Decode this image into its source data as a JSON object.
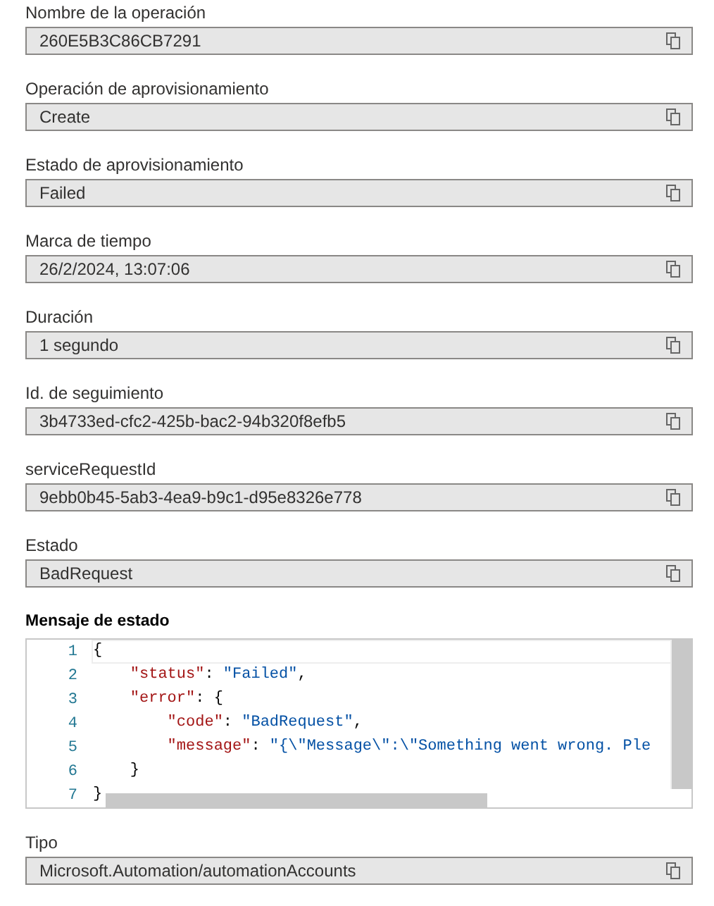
{
  "fields": [
    {
      "kind": "text",
      "label": "Nombre de la operación",
      "value": "260E5B3C86CB7291"
    },
    {
      "kind": "text",
      "label": "Operación de aprovisionamiento",
      "value": "Create"
    },
    {
      "kind": "text",
      "label": "Estado de aprovisionamiento",
      "value": "Failed"
    },
    {
      "kind": "text",
      "label": "Marca de tiempo",
      "value": "26/2/2024, 13:07:06"
    },
    {
      "kind": "text",
      "label": "Duración",
      "value": "1 segundo"
    },
    {
      "kind": "text",
      "label": "Id. de seguimiento",
      "value": "3b4733ed-cfc2-425b-bac2-94b320f8efb5"
    },
    {
      "kind": "text",
      "label": "serviceRequestId",
      "value": "9ebb0b45-5ab3-4ea9-b9c1-d95e8326e778"
    },
    {
      "kind": "text",
      "label": "Estado",
      "value": "BadRequest"
    },
    {
      "kind": "code",
      "label": "Mensaje de estado",
      "lines": [
        {
          "number": "1",
          "selected": true,
          "tokens": [
            {
              "kind": "punct",
              "text": "{"
            }
          ]
        },
        {
          "number": "2",
          "selected": false,
          "tokens": [
            {
              "kind": "key",
              "text": "    \"status\""
            },
            {
              "kind": "punct",
              "text": ": "
            },
            {
              "kind": "string",
              "text": "\"Failed\""
            },
            {
              "kind": "punct",
              "text": ","
            }
          ]
        },
        {
          "number": "3",
          "selected": false,
          "tokens": [
            {
              "kind": "key",
              "text": "    \"error\""
            },
            {
              "kind": "punct",
              "text": ": {"
            }
          ]
        },
        {
          "number": "4",
          "selected": false,
          "tokens": [
            {
              "kind": "key",
              "text": "        \"code\""
            },
            {
              "kind": "punct",
              "text": ": "
            },
            {
              "kind": "string",
              "text": "\"BadRequest\""
            },
            {
              "kind": "punct",
              "text": ","
            }
          ]
        },
        {
          "number": "5",
          "selected": false,
          "tokens": [
            {
              "kind": "key",
              "text": "        \"message\""
            },
            {
              "kind": "punct",
              "text": ": "
            },
            {
              "kind": "string",
              "text": "\"{\\\"Message\\\":\\\"Something went wrong. Ple"
            }
          ]
        },
        {
          "number": "6",
          "selected": false,
          "tokens": [
            {
              "kind": "punct",
              "text": "    }"
            }
          ]
        },
        {
          "number": "7",
          "selected": false,
          "tokens": [
            {
              "kind": "punct",
              "text": "}"
            }
          ]
        }
      ]
    },
    {
      "kind": "text",
      "label": "Tipo",
      "value": "Microsoft.Automation/automationAccounts"
    }
  ]
}
